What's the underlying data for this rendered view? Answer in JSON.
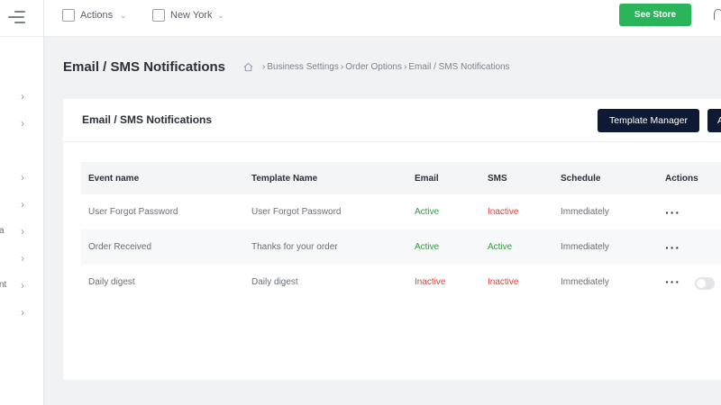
{
  "topbar": {
    "actions_label": "Actions",
    "location_label": "New York",
    "see_store_label": "See Store"
  },
  "sidebar": {
    "fragments": [
      "a",
      "nt"
    ]
  },
  "page": {
    "title": "Email / SMS Notifications",
    "breadcrumb": [
      "Business Settings",
      "Order Options",
      "Email / SMS Notifications"
    ]
  },
  "card": {
    "title": "Email / SMS Notifications",
    "template_manager_label": "Template Manager",
    "add_label": "A"
  },
  "table": {
    "columns": [
      "Event name",
      "Template Name",
      "Email",
      "SMS",
      "Schedule",
      "Actions"
    ],
    "rows": [
      {
        "event": "User Forgot Password",
        "template": "User Forgot Password",
        "email": "Active",
        "sms": "Inactive",
        "schedule": "Immediately"
      },
      {
        "event": "Order Received",
        "template": "Thanks for your order",
        "email": "Active",
        "sms": "Active",
        "schedule": "Immediately"
      },
      {
        "event": "Daily digest",
        "template": "Daily digest",
        "email": "Inactive",
        "sms": "Inactive",
        "schedule": "Immediately",
        "toggle": "off"
      }
    ],
    "actions_glyph": "···"
  },
  "colors": {
    "active": "#2c9e3f",
    "inactive": "#e0413d",
    "primary_dark": "#0e1a33",
    "store_green": "#2bb55a"
  }
}
